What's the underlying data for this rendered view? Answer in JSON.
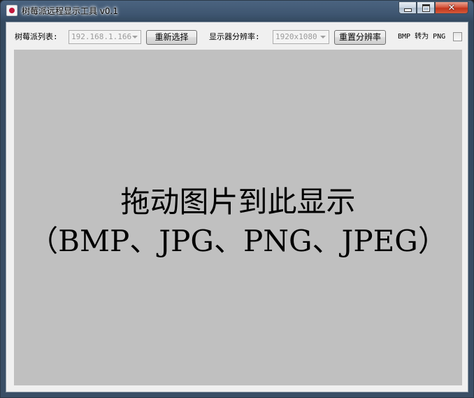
{
  "window": {
    "title": "树莓派远程显示工具 v0.1",
    "controls": {
      "minimize": "minimize",
      "maximize": "maximize",
      "close": "✕"
    }
  },
  "toolbar": {
    "pi_list_label": "树莓派列表:",
    "pi_list_value": "192.168.1.166",
    "reselect_button": "重新选择",
    "resolution_label": "显示器分辨率:",
    "resolution_value": "1920x1080",
    "reset_resolution_button": "重置分辨率",
    "bmp_to_png_label": "BMP 转为 PNG",
    "bmp_to_png_checked": false
  },
  "drop_area": {
    "line1": "拖动图片到此显示",
    "line2": "（BMP、JPG、PNG、JPEG）"
  },
  "icons": {
    "app_icon": "raspberry-pi-icon",
    "combo_arrow": "chevron-down-icon"
  },
  "colors": {
    "drop_area_bg": "#c0c0c0",
    "client_bg": "#f0f0f0",
    "close_button": "#c2351d"
  }
}
